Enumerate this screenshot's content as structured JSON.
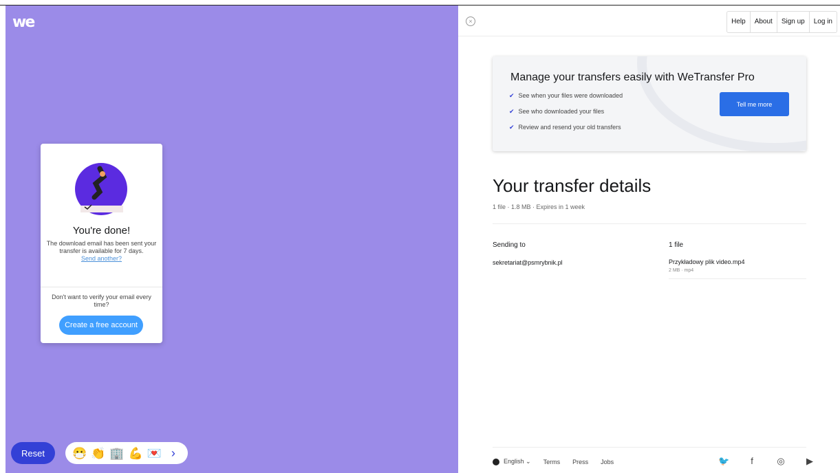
{
  "brand": {
    "logo": "we"
  },
  "left": {
    "card": {
      "title": "You're done!",
      "text": "The download email has been sent your transfer is available for 7 days.",
      "link": "Send another?",
      "verify_text": "Don't want to verify your email every time?",
      "button": "Create a free account"
    },
    "reset_button": "Reset",
    "toolbar": {
      "icons": [
        "mask-emoji",
        "hand-emoji",
        "building-emoji",
        "flex-emoji",
        "envelope-emoji"
      ],
      "glyphs": [
        "😷",
        "👏",
        "🏢",
        "💪",
        "💌"
      ],
      "next": "›"
    },
    "colors": {
      "background": "#9b8be8",
      "accent": "#3340d6"
    }
  },
  "right": {
    "close": "×",
    "nav": [
      "Help",
      "About",
      "Sign up",
      "Log in"
    ],
    "promo": {
      "title": "Manage your transfers easily with WeTransfer Pro",
      "items": [
        "See when your files were downloaded",
        "See who downloaded your files",
        "Review and resend your old transfers"
      ],
      "button": "Tell me more"
    },
    "details": {
      "title": "Your transfer details",
      "meta": "1 file · 1.8 MB · Expires in 1 week",
      "sending_to_label": "Sending to",
      "files_label": "1 file",
      "recipient": "sekretariat@psmrybnik.pl",
      "file_name": "Przykładowy plik video.mp4",
      "file_meta": "2 MB · mp4"
    },
    "footer": {
      "language": "English",
      "links": [
        "Terms",
        "Press",
        "Jobs"
      ],
      "social": [
        "twitter-icon",
        "facebook-icon",
        "instagram-icon",
        "youtube-icon"
      ],
      "social_glyphs": [
        "🐦",
        "f",
        "◎",
        "▶"
      ]
    }
  }
}
